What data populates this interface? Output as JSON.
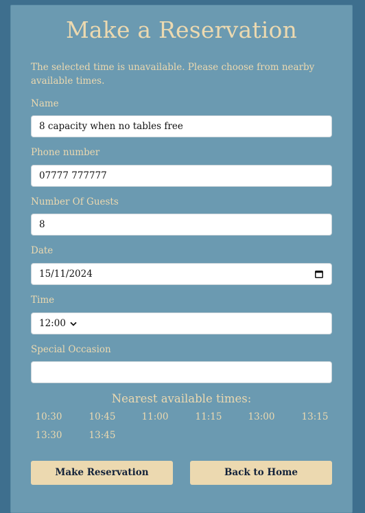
{
  "page": {
    "title": "Make a Reservation",
    "notice": "The selected time is unavailable. Please choose from nearby available times."
  },
  "form": {
    "name_label": "Name",
    "name_value": "8 capacity when no tables free",
    "phone_label": "Phone number",
    "phone_value": "07777 777777",
    "guests_label": "Number Of Guests",
    "guests_value": "8",
    "date_label": "Date",
    "date_value": "15/11/2024",
    "time_label": "Time",
    "time_value": "12:00",
    "occasion_label": "Special Occasion",
    "occasion_value": ""
  },
  "nearest": {
    "title": "Nearest available times:",
    "times": [
      "10:30",
      "10:45",
      "11:00",
      "11:15",
      "13:00",
      "13:15",
      "13:30",
      "13:45"
    ]
  },
  "buttons": {
    "make_label": "Make Reservation",
    "home_label": "Back to Home"
  },
  "colors": {
    "background": "#3e6f8e",
    "card": "#6b9ab1",
    "accent": "#ecd9b0",
    "button_text": "#13223a"
  }
}
